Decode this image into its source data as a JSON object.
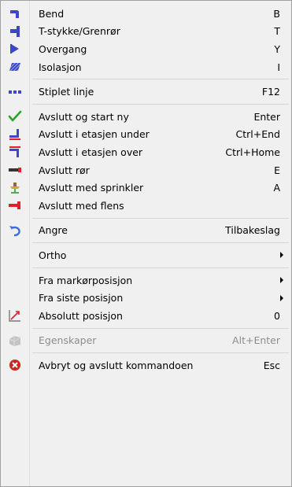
{
  "menu": {
    "groups": [
      [
        {
          "label": "Bend",
          "shortcut": "B",
          "icon": "bend-icon"
        },
        {
          "label": "T-stykke/Grenrør",
          "shortcut": "T",
          "icon": "tee-icon"
        },
        {
          "label": "Overgang",
          "shortcut": "Y",
          "icon": "reducer-icon"
        },
        {
          "label": "Isolasjon",
          "shortcut": "I",
          "icon": "insulation-icon"
        }
      ],
      [
        {
          "label": "Stiplet linje",
          "shortcut": "F12",
          "icon": "dashed-line-icon"
        }
      ],
      [
        {
          "label": "Avslutt og start ny",
          "shortcut": "Enter",
          "icon": "checkmark-icon"
        },
        {
          "label": "Avslutt i etasjen under",
          "shortcut": "Ctrl+End",
          "icon": "floor-below-icon"
        },
        {
          "label": "Avslutt i etasjen over",
          "shortcut": "Ctrl+Home",
          "icon": "floor-above-icon"
        },
        {
          "label": "Avslutt rør",
          "shortcut": "E",
          "icon": "pipe-end-icon"
        },
        {
          "label": "Avslutt med sprinkler",
          "shortcut": "A",
          "icon": "sprinkler-icon"
        },
        {
          "label": "Avslutt med flens",
          "shortcut": "",
          "icon": "flange-icon"
        }
      ],
      [
        {
          "label": "Angre",
          "shortcut": "Tilbakeslag",
          "icon": "undo-icon"
        }
      ],
      [
        {
          "label": "Ortho",
          "submenu": true
        }
      ],
      [
        {
          "label": "Fra markørposisjon",
          "submenu": true
        },
        {
          "label": "Fra siste posisjon",
          "submenu": true
        },
        {
          "label": "Absolutt posisjon",
          "shortcut": "0",
          "icon": "absolute-position-icon"
        }
      ],
      [
        {
          "label": "Egenskaper",
          "shortcut": "Alt+Enter",
          "icon": "properties-icon",
          "disabled": true
        }
      ],
      [
        {
          "label": "Avbryt og avslutt kommandoen",
          "shortcut": "Esc",
          "icon": "cancel-icon"
        }
      ]
    ]
  },
  "colors": {
    "menu_background": "#f0f0f0",
    "pipe_blue": "#3c46c8",
    "check_green": "#2aa52a",
    "end_red": "#e0202c",
    "cancel_red": "#c8281e",
    "disabled_text": "#8d8d8d"
  }
}
